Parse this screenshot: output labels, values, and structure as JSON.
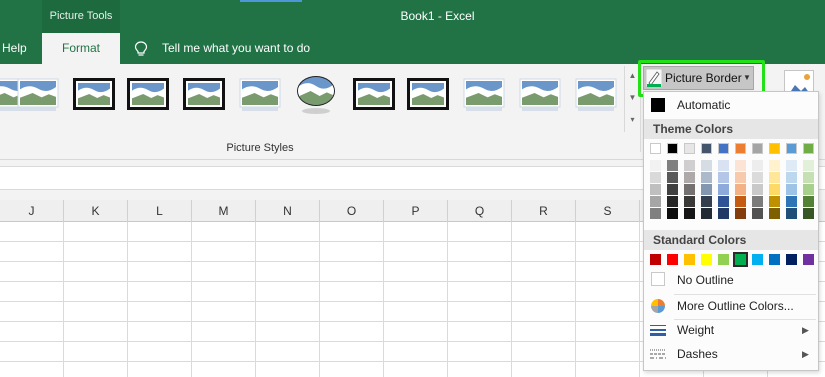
{
  "titlebar": {
    "context_tab_group": "Picture Tools",
    "document_title": "Book1  -  Excel"
  },
  "tabs": [
    {
      "label": "Help"
    },
    {
      "label": "Format"
    }
  ],
  "tell_me": {
    "placeholder": "Tell me what you want to do"
  },
  "ribbon": {
    "group_label": "Picture Styles",
    "picture_border_label": "Picture Border",
    "picture_styles": [
      "simple-frame",
      "soft-edge",
      "shadow-rectangle",
      "thick-black-frame",
      "black-shadow",
      "beveled-matte",
      "oval",
      "metal-frame",
      "black-thick-matte",
      "reflected",
      "rounded-reflected",
      "drop-shadow-rounded"
    ]
  },
  "columns": [
    "J",
    "K",
    "L",
    "M",
    "N",
    "O",
    "P",
    "Q",
    "R",
    "S"
  ],
  "border_menu": {
    "automatic_label": "Automatic",
    "theme_colors_header": "Theme Colors",
    "standard_colors_header": "Standard Colors",
    "no_outline_label": "No Outline",
    "more_colors_label": "More Outline Colors...",
    "weight_label": "Weight",
    "dashes_label": "Dashes",
    "theme_colors": [
      "#ffffff",
      "#000000",
      "#e7e6e6",
      "#44546a",
      "#4472c4",
      "#ed7d31",
      "#a5a5a5",
      "#ffc000",
      "#5b9bd5",
      "#70ad47"
    ],
    "theme_shades": [
      [
        "#f2f2f2",
        "#d9d9d9",
        "#bfbfbf",
        "#a6a6a6",
        "#808080"
      ],
      [
        "#808080",
        "#595959",
        "#404040",
        "#262626",
        "#0d0d0d"
      ],
      [
        "#d0cece",
        "#aeaaaa",
        "#757171",
        "#3b3838",
        "#161616"
      ],
      [
        "#d6dce4",
        "#acb9ca",
        "#8497b0",
        "#333f4f",
        "#222a35"
      ],
      [
        "#d9e2f3",
        "#b4c6e7",
        "#8eaadb",
        "#2f5496",
        "#1f3864"
      ],
      [
        "#fbe4d5",
        "#f7caac",
        "#f4b183",
        "#c55a11",
        "#833c0b"
      ],
      [
        "#ededed",
        "#dbdbdb",
        "#c9c9c9",
        "#7b7b7b",
        "#525252"
      ],
      [
        "#fff2cc",
        "#ffe699",
        "#ffd966",
        "#bf9000",
        "#7f6000"
      ],
      [
        "#deebf6",
        "#bdd7ee",
        "#9dc3e6",
        "#2e75b5",
        "#1f4e79"
      ],
      [
        "#e2efd9",
        "#c5e0b3",
        "#a8d08d",
        "#538135",
        "#375623"
      ]
    ],
    "standard_colors": [
      "#c00000",
      "#ff0000",
      "#ffc000",
      "#ffff00",
      "#92d050",
      "#00b050",
      "#00b0f0",
      "#0070c0",
      "#002060",
      "#7030a0"
    ],
    "selected_standard_color": "#00b050"
  }
}
